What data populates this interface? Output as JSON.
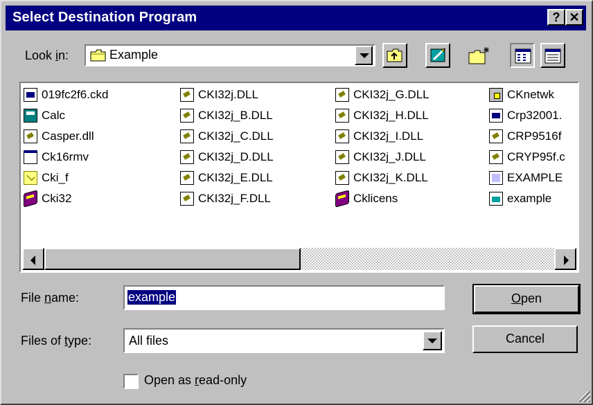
{
  "window": {
    "title": "Select Destination Program",
    "help_button": "?",
    "close_button": "✕"
  },
  "lookin": {
    "label_pre": "Look ",
    "label_u": "i",
    "label_post": "n:",
    "value": "Example",
    "folder_icon": "folder-icon"
  },
  "toolbar": {
    "up_icon": "up-one-level-icon",
    "desktop_icon": "desktop-icon",
    "new_folder_icon": "new-folder-icon",
    "list_icon": "list-view-icon",
    "details_icon": "details-view-icon"
  },
  "files": {
    "col1": [
      {
        "name": "019fc2f6.ckd",
        "icon": "doc"
      },
      {
        "name": "Calc",
        "icon": "calc"
      },
      {
        "name": "Casper.dll",
        "icon": "dll"
      },
      {
        "name": "Ck16rmv",
        "icon": "app"
      },
      {
        "name": "Cki_f",
        "icon": "mail"
      },
      {
        "name": "Cki32",
        "icon": "book"
      }
    ],
    "col2": [
      {
        "name": "CKI32j.DLL",
        "icon": "dll"
      },
      {
        "name": "CKI32j_B.DLL",
        "icon": "dll"
      },
      {
        "name": "CKI32j_C.DLL",
        "icon": "dll"
      },
      {
        "name": "CKI32j_D.DLL",
        "icon": "dll"
      },
      {
        "name": "CKI32j_E.DLL",
        "icon": "dll"
      },
      {
        "name": "CKI32j_F.DLL",
        "icon": "dll"
      }
    ],
    "col3": [
      {
        "name": "CKI32j_G.DLL",
        "icon": "dll"
      },
      {
        "name": "CKI32j_H.DLL",
        "icon": "dll"
      },
      {
        "name": "CKI32j_I.DLL",
        "icon": "dll"
      },
      {
        "name": "CKI32j_J.DLL",
        "icon": "dll"
      },
      {
        "name": "CKI32j_K.DLL",
        "icon": "dll"
      },
      {
        "name": "Cklicens",
        "icon": "book"
      }
    ],
    "col4": [
      {
        "name": "CKnetwk",
        "icon": "net"
      },
      {
        "name": "Crp32001.",
        "icon": "doc"
      },
      {
        "name": "CRP9516f",
        "icon": "dll"
      },
      {
        "name": "CRYP95f.c",
        "icon": "dll"
      },
      {
        "name": "EXAMPLE",
        "icon": "gen"
      },
      {
        "name": "example",
        "icon": "ex"
      }
    ]
  },
  "filename": {
    "label_pre": "File ",
    "label_u": "n",
    "label_post": "ame:",
    "value": "example"
  },
  "filetype": {
    "label_pre": "Files of ",
    "label_u": "t",
    "label_post": "ype:",
    "value": "All files"
  },
  "buttons": {
    "open_u": "O",
    "open_rest": "pen",
    "cancel": "Cancel"
  },
  "readonly": {
    "label_pre": "Open as ",
    "label_u": "r",
    "label_post": "ead-only"
  }
}
